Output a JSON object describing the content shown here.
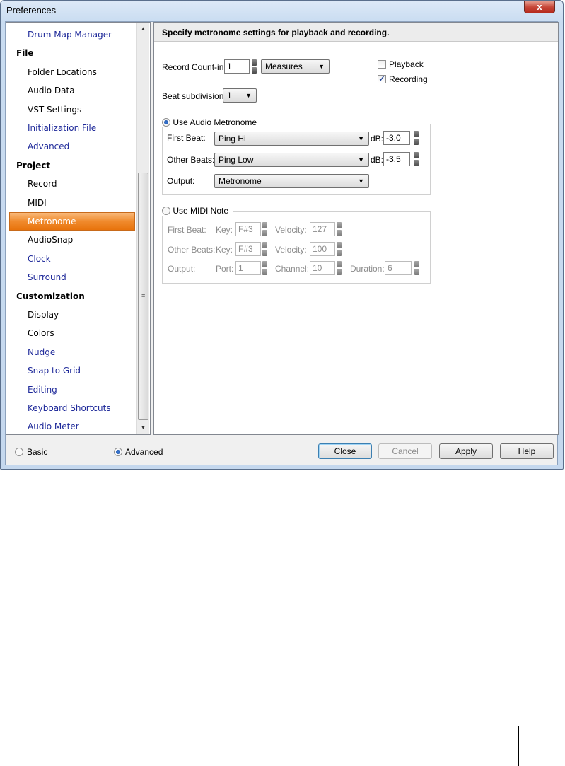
{
  "window": {
    "title": "Preferences",
    "close_glyph": "x"
  },
  "tree": {
    "items": [
      {
        "label": "Drum Map Manager",
        "kind": "sub"
      },
      {
        "label": "File",
        "kind": "cat"
      },
      {
        "label": "Folder Locations",
        "kind": "sub-dark"
      },
      {
        "label": "Audio Data",
        "kind": "sub-dark"
      },
      {
        "label": "VST Settings",
        "kind": "sub-dark"
      },
      {
        "label": "Initialization File",
        "kind": "sub"
      },
      {
        "label": "Advanced",
        "kind": "sub"
      },
      {
        "label": "Project",
        "kind": "cat"
      },
      {
        "label": "Record",
        "kind": "sub-dark"
      },
      {
        "label": "MIDI",
        "kind": "sub-dark"
      },
      {
        "label": "Metronome",
        "kind": "selected"
      },
      {
        "label": "AudioSnap",
        "kind": "sub-dark"
      },
      {
        "label": "Clock",
        "kind": "sub"
      },
      {
        "label": "Surround",
        "kind": "sub"
      },
      {
        "label": "Customization",
        "kind": "cat"
      },
      {
        "label": "Display",
        "kind": "sub-dark"
      },
      {
        "label": "Colors",
        "kind": "sub-dark"
      },
      {
        "label": "Nudge",
        "kind": "sub"
      },
      {
        "label": "Snap to Grid",
        "kind": "sub"
      },
      {
        "label": "Editing",
        "kind": "sub"
      },
      {
        "label": "Keyboard Shortcuts",
        "kind": "sub"
      },
      {
        "label": "Audio Meter",
        "kind": "sub"
      }
    ],
    "scroll_up_glyph": "▲",
    "scroll_down_glyph": "▼",
    "grip_glyph": "≡"
  },
  "panel": {
    "header": "Specify metronome settings for playback and recording.",
    "record_count_in_label": "Record Count-in:",
    "record_count_in_value": "1",
    "count_unit": "Measures",
    "playback_label": "Playback",
    "playback_checked": false,
    "recording_label": "Recording",
    "recording_checked": true,
    "check_glyph": "✓",
    "beat_subdivision_label": "Beat subdivision:",
    "beat_subdivision_value": "1",
    "audio_metronome": {
      "label": "Use Audio Metronome",
      "selected": true,
      "first_beat_label": "First Beat:",
      "first_beat_value": "Ping Hi",
      "first_db_label": "dB:",
      "first_db_value": "-3.0",
      "other_beats_label": "Other Beats:",
      "other_beats_value": "Ping Low",
      "other_db_label": "dB:",
      "other_db_value": "-3.5",
      "output_label": "Output:",
      "output_value": "Metronome"
    },
    "midi_note": {
      "label": "Use MIDI Note",
      "selected": false,
      "first_beat_label": "First Beat:",
      "first_key_label": "Key:",
      "first_key_value": "F#3",
      "first_velocity_label": "Velocity:",
      "first_velocity_value": "127",
      "other_beats_label": "Other Beats:",
      "other_key_label": "Key:",
      "other_key_value": "F#3",
      "other_velocity_label": "Velocity:",
      "other_velocity_value": "100",
      "output_label": "Output:",
      "port_label": "Port:",
      "port_value": "1",
      "channel_label": "Channel:",
      "channel_value": "10",
      "duration_label": "Duration:",
      "duration_value": "6"
    },
    "dropdown_glyph": "▼"
  },
  "footer": {
    "mode_basic": "Basic",
    "mode_advanced": "Advanced",
    "mode_selected": "Advanced",
    "close": "Close",
    "cancel": "Cancel",
    "apply": "Apply",
    "help": "Help"
  }
}
